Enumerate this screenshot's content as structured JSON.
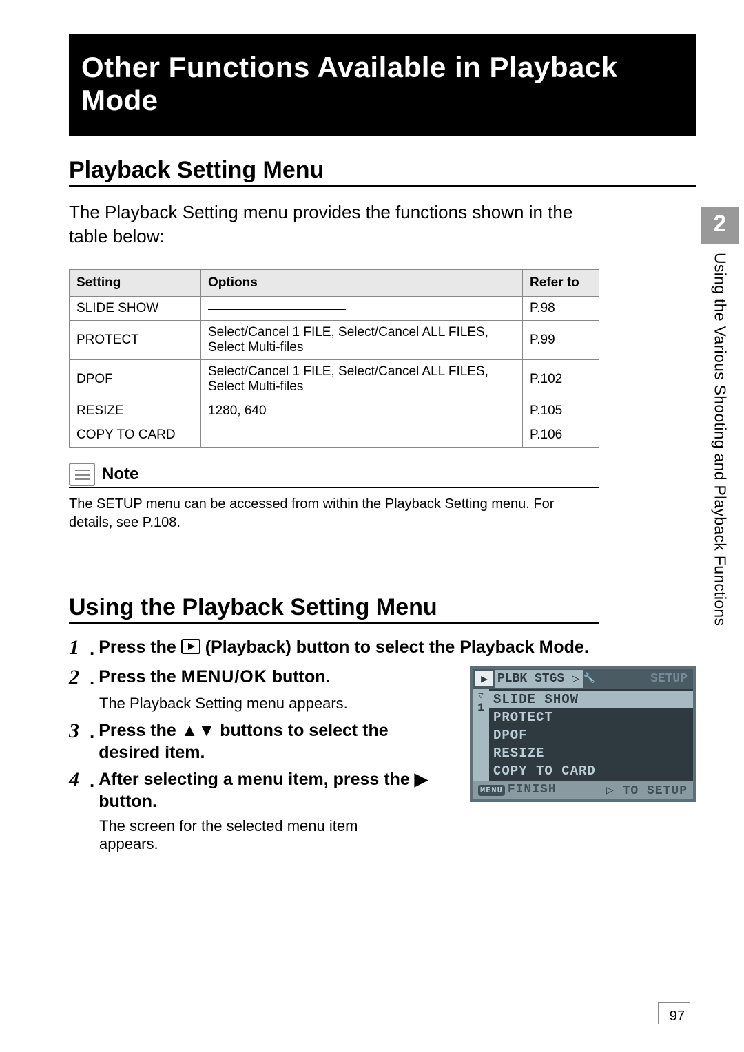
{
  "banner_title": "Other Functions Available in Playback Mode",
  "section1_heading": "Playback Setting Menu",
  "intro_text": "The Playback Setting menu provides the functions shown in the table below:",
  "table": {
    "headers": {
      "setting": "Setting",
      "options": "Options",
      "refer": "Refer to"
    },
    "rows": [
      {
        "setting": "SLIDE SHOW",
        "options": "",
        "refer": "P.98"
      },
      {
        "setting": "PROTECT",
        "options": "Select/Cancel 1 FILE, Select/Cancel ALL FILES, Select Multi-files",
        "refer": "P.99"
      },
      {
        "setting": "DPOF",
        "options": "Select/Cancel 1 FILE, Select/Cancel ALL FILES, Select Multi-files",
        "refer": "P.102"
      },
      {
        "setting": "RESIZE",
        "options": "1280, 640",
        "refer": "P.105"
      },
      {
        "setting": "COPY TO CARD",
        "options": "",
        "refer": "P.106"
      }
    ]
  },
  "note": {
    "label": "Note",
    "text": "The SETUP menu can be accessed from within the Playback Setting menu. For details, see P.108."
  },
  "section2_heading": "Using the Playback Setting Menu",
  "steps": {
    "s1_num": "1",
    "s1_text_a": "Press the ",
    "s1_text_b": " (Playback) button to select the Playback Mode.",
    "s2_num": "2",
    "s2_text_a": "Press the ",
    "s2_menu": "MENU/OK",
    "s2_text_b": " button.",
    "s2_sub": "The Playback Setting menu appears.",
    "s3_num": "3",
    "s3_text_a": "Press the ",
    "s3_text_b": " buttons to select the desired item.",
    "s4_num": "4",
    "s4_text_a": "After selecting a menu item, press the ",
    "s4_text_b": " button.",
    "s4_sub": "The screen for the selected menu item appears."
  },
  "screen": {
    "tab_active": "PLBK STGS",
    "tab_other": "SETUP",
    "page_indicator": "1",
    "items": [
      "SLIDE SHOW",
      "PROTECT",
      "DPOF",
      "RESIZE",
      "COPY TO CARD"
    ],
    "finish": "FINISH",
    "to_setup": "TO SETUP"
  },
  "chapter_num": "2",
  "chapter_label": "Using the Various Shooting and Playback Functions",
  "page_number": "97"
}
